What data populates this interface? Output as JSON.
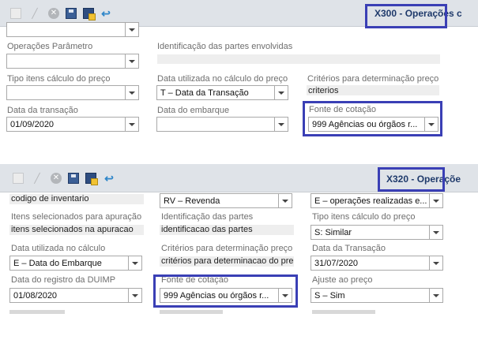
{
  "panel1": {
    "title": "X300 - Operações c",
    "fields": {
      "operacoes_parametro_label": "Operações Parâmetro",
      "identificacao_label": "Identificação das partes envolvidas",
      "tipo_itens_label": "Tipo itens cálculo do preço",
      "data_utilizada_label": "Data utilizada no cálculo do preço",
      "data_utilizada_value": "T – Data da Transação",
      "criterios_label": "Critérios para determinação preço",
      "criterios_value": "criterios",
      "data_transacao_label": "Data da transação",
      "data_transacao_value": "01/09/2020",
      "data_embarque_label": "Data do embarque",
      "fonte_cotacao_label": "Fonte de cotação",
      "fonte_cotacao_value": "999    Agências ou órgãos r..."
    }
  },
  "panel2": {
    "title": "X320 - Operaçõe",
    "fields": {
      "codigo_inventario_value": "codigo de inventario",
      "rv_value": "RV – Revenda",
      "operacoes_realizadas_value": "E – operações realizadas e...",
      "itens_selecionados_label": "Itens selecionados para apuração",
      "itens_selecionados_value": "itens selecionados na apuracao",
      "identificacao_label": "Identificação das partes",
      "identificacao_value": "identificacao das partes",
      "tipo_itens_label": "Tipo itens cálculo do preço",
      "tipo_itens_value": "S: Similar",
      "data_utilizada_label": "Data utilizada no cálculo",
      "data_utilizada_value": "E – Data do Embarque",
      "criterios_label": "Critérios para determinação preço",
      "criterios_value": "critérios para determinacao do preço",
      "data_transacao_label": "Data da Transação",
      "data_transacao_value": "31/07/2020",
      "data_registro_label": "Data do registro da DUIMP",
      "data_registro_value": "01/08/2020",
      "fonte_cotacao_label": "Fonte de cotação",
      "fonte_cotacao_value": "999    Agências ou órgãos r...",
      "ajuste_label": "Ajuste ao preço",
      "ajuste_value": "S – Sim"
    }
  },
  "colors": {
    "highlight": "#3a3fb5",
    "toolbar_bg": "#dfe3e8",
    "title_text": "#1f3a6b"
  }
}
